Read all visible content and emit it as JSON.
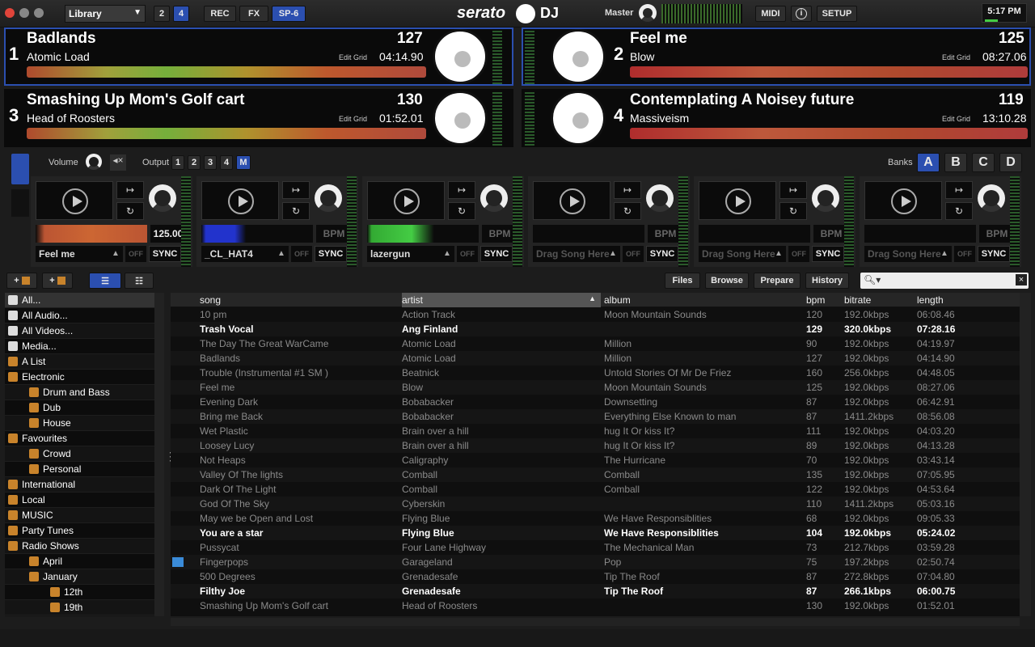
{
  "topbar": {
    "library": "Library",
    "deck_btn_2": "2",
    "deck_btn_4": "4",
    "rec": "REC",
    "fx": "FX",
    "sp6": "SP-6",
    "logo": "serato",
    "logo_dj": "DJ",
    "master": "Master",
    "midi": "MIDI",
    "info": "i",
    "setup": "SETUP",
    "clock": "5:17 PM"
  },
  "decks": [
    {
      "num": "1",
      "title": "Badlands",
      "artist": "Atomic Load",
      "bpm": "127",
      "time": "04:14.90",
      "edit": "Edit Grid"
    },
    {
      "num": "2",
      "title": "Feel me",
      "artist": "Blow",
      "bpm": "125",
      "time": "08:27.06",
      "edit": "Edit Grid"
    },
    {
      "num": "3",
      "title": "Smashing Up Mom's Golf cart",
      "artist": "Head of Roosters",
      "bpm": "130",
      "time": "01:52.01",
      "edit": "Edit Grid"
    },
    {
      "num": "4",
      "title": "Contemplating A Noisey future",
      "artist": "Massiveism",
      "bpm": "119",
      "time": "13:10.28",
      "edit": "Edit Grid"
    }
  ],
  "sampler": {
    "volume": "Volume",
    "output": "Output",
    "outs": [
      "1",
      "2",
      "3",
      "4",
      "M"
    ],
    "banks": "Banks",
    "bank_letters": [
      "A",
      "B",
      "C",
      "D"
    ],
    "slots": [
      {
        "name": "Feel me",
        "bpm": "125.00",
        "empty": false
      },
      {
        "name": "_CL_HAT4",
        "bpm": "BPM",
        "empty": false
      },
      {
        "name": "lazergun",
        "bpm": "BPM",
        "empty": false
      },
      {
        "name": "Drag Song Here",
        "bpm": "BPM",
        "empty": true
      },
      {
        "name": "Drag Song Here",
        "bpm": "BPM",
        "empty": true
      },
      {
        "name": "Drag Song Here",
        "bpm": "BPM",
        "empty": true
      }
    ],
    "off": "OFF",
    "sync": "SYNC"
  },
  "browser": {
    "tabs": [
      "Files",
      "Browse",
      "Prepare",
      "History"
    ],
    "search_placeholder": ""
  },
  "tree": [
    {
      "label": "All...",
      "icon": "w",
      "indent": 0
    },
    {
      "label": "All Audio...",
      "icon": "w",
      "indent": 0
    },
    {
      "label": "All Videos...",
      "icon": "w",
      "indent": 0
    },
    {
      "label": "Media...",
      "icon": "w",
      "indent": 0
    },
    {
      "label": "A List",
      "icon": "o",
      "indent": 0
    },
    {
      "label": "Electronic",
      "icon": "o",
      "indent": 0
    },
    {
      "label": "Drum and Bass",
      "icon": "o",
      "indent": 1
    },
    {
      "label": "Dub",
      "icon": "o",
      "indent": 1
    },
    {
      "label": "House",
      "icon": "o",
      "indent": 1
    },
    {
      "label": "Favourites",
      "icon": "o",
      "indent": 0
    },
    {
      "label": "Crowd",
      "icon": "o",
      "indent": 1
    },
    {
      "label": "Personal",
      "icon": "o",
      "indent": 1
    },
    {
      "label": "International",
      "icon": "o",
      "indent": 0
    },
    {
      "label": "Local",
      "icon": "o",
      "indent": 0
    },
    {
      "label": "MUSIC",
      "icon": "o",
      "indent": 0
    },
    {
      "label": "Party Tunes",
      "icon": "o",
      "indent": 0
    },
    {
      "label": "Radio Shows",
      "icon": "o",
      "indent": 0
    },
    {
      "label": "April",
      "icon": "o",
      "indent": 1
    },
    {
      "label": "January",
      "icon": "o",
      "indent": 1
    },
    {
      "label": "12th",
      "icon": "o",
      "indent": 2
    },
    {
      "label": "19th",
      "icon": "o",
      "indent": 2
    }
  ],
  "columns": {
    "song": "song",
    "artist": "artist",
    "album": "album",
    "bpm": "bpm",
    "bitrate": "bitrate",
    "length": "length"
  },
  "tracks": [
    {
      "song": "10 pm",
      "artist": "Action Track",
      "album": "Moon Mountain Sounds",
      "bpm": "120",
      "bitrate": "192.0kbps",
      "length": "06:08.46",
      "hi": false
    },
    {
      "song": "Trash Vocal",
      "artist": "Ang Finland",
      "album": "",
      "bpm": "129",
      "bitrate": "320.0kbps",
      "length": "07:28.16",
      "hi": true
    },
    {
      "song": "The Day The Great WarCame",
      "artist": "Atomic Load",
      "album": "Million",
      "bpm": "90",
      "bitrate": "192.0kbps",
      "length": "04:19.97",
      "hi": false
    },
    {
      "song": "Badlands",
      "artist": "Atomic Load",
      "album": "Million",
      "bpm": "127",
      "bitrate": "192.0kbps",
      "length": "04:14.90",
      "hi": false
    },
    {
      "song": "Trouble (Instrumental #1 SM )",
      "artist": "Beatnick",
      "album": "Untold Stories Of Mr De Friez",
      "bpm": "160",
      "bitrate": "256.0kbps",
      "length": "04:48.05",
      "hi": false
    },
    {
      "song": "Feel me",
      "artist": "Blow",
      "album": "Moon Mountain Sounds",
      "bpm": "125",
      "bitrate": "192.0kbps",
      "length": "08:27.06",
      "hi": false
    },
    {
      "song": "Evening Dark",
      "artist": "Bobabacker",
      "album": "Downsetting",
      "bpm": "87",
      "bitrate": "192.0kbps",
      "length": "06:42.91",
      "hi": false
    },
    {
      "song": "Bring me Back",
      "artist": "Bobabacker",
      "album": "Everything Else Known to man",
      "bpm": "87",
      "bitrate": "1411.2kbps",
      "length": "08:56.08",
      "hi": false
    },
    {
      "song": "Wet Plastic",
      "artist": "Brain over a hill",
      "album": "hug It Or kiss It?",
      "bpm": "111",
      "bitrate": "192.0kbps",
      "length": "04:03.20",
      "hi": false
    },
    {
      "song": "Loosey Lucy",
      "artist": "Brain over a hill",
      "album": "hug It Or kiss It?",
      "bpm": "89",
      "bitrate": "192.0kbps",
      "length": "04:13.28",
      "hi": false
    },
    {
      "song": "Not Heaps",
      "artist": "Caligraphy",
      "album": "The Hurricane",
      "bpm": "70",
      "bitrate": "192.0kbps",
      "length": "03:43.14",
      "hi": false
    },
    {
      "song": "Valley Of The lights",
      "artist": "Comball",
      "album": "Comball",
      "bpm": "135",
      "bitrate": "192.0kbps",
      "length": "07:05.95",
      "hi": false
    },
    {
      "song": "Dark Of The Light",
      "artist": "Comball",
      "album": "Comball",
      "bpm": "122",
      "bitrate": "192.0kbps",
      "length": "04:53.64",
      "hi": false
    },
    {
      "song": "God Of The Sky",
      "artist": "Cyberskin",
      "album": "",
      "bpm": "110",
      "bitrate": "1411.2kbps",
      "length": "05:03.16",
      "hi": false
    },
    {
      "song": "May we be Open and Lost",
      "artist": "Flying Blue",
      "album": "We Have Responsiblities",
      "bpm": "68",
      "bitrate": "192.0kbps",
      "length": "09:05.33",
      "hi": false
    },
    {
      "song": "You are a star",
      "artist": "Flying Blue",
      "album": "We Have Responsiblities",
      "bpm": "104",
      "bitrate": "192.0kbps",
      "length": "05:24.02",
      "hi": true
    },
    {
      "song": "Pussycat",
      "artist": "Four Lane Highway",
      "album": "The Mechanical Man",
      "bpm": "73",
      "bitrate": "212.7kbps",
      "length": "03:59.28",
      "hi": false
    },
    {
      "song": "Fingerpops",
      "artist": "Garageland",
      "album": "Pop",
      "bpm": "75",
      "bitrate": "197.2kbps",
      "length": "02:50.74",
      "hi": false
    },
    {
      "song": "500 Degrees",
      "artist": "Grenadesafe",
      "album": "Tip The Roof",
      "bpm": "87",
      "bitrate": "272.8kbps",
      "length": "07:04.80",
      "hi": false
    },
    {
      "song": "Filthy Joe",
      "artist": "Grenadesafe",
      "album": "Tip The Roof",
      "bpm": "87",
      "bitrate": "266.1kbps",
      "length": "06:00.75",
      "hi": true
    },
    {
      "song": "Smashing Up Mom's Golf cart",
      "artist": "Head of Roosters",
      "album": "",
      "bpm": "130",
      "bitrate": "192.0kbps",
      "length": "01:52.01",
      "hi": false
    }
  ]
}
